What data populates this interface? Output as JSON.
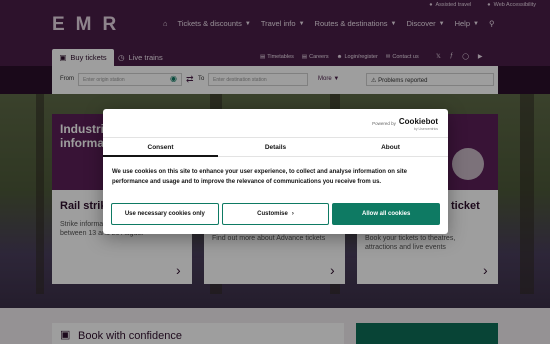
{
  "header": {
    "logo": "EMR",
    "utility_links": [
      "Assisted travel",
      "Web Accessibility"
    ],
    "nav": [
      {
        "label": "Tickets & discounts"
      },
      {
        "label": "Travel info"
      },
      {
        "label": "Routes & destinations"
      },
      {
        "label": "Discover"
      },
      {
        "label": "Help"
      }
    ]
  },
  "tabs": {
    "buy": "Buy tickets",
    "live": "Live trains"
  },
  "secondary_links": [
    "Timetables",
    "Careers",
    "Login/register",
    "Contact us"
  ],
  "social_icons": [
    "twitter-icon",
    "facebook-icon",
    "instagram-icon",
    "youtube-icon"
  ],
  "planner": {
    "from_label": "From",
    "from_placeholder": "Enter origin station",
    "to_label": "To",
    "to_placeholder": "Enter destination station",
    "more_label": "More",
    "problems_label": "Problems reported"
  },
  "background": {
    "banner_text": "Industrial action information",
    "cards": [
      {
        "title": "Rail strikes",
        "text": "Strike information for our rail network between 13 and 20 August"
      },
      {
        "title": "",
        "text": "Find out more about Advance tickets"
      },
      {
        "title": "ticket",
        "text": "Book your tickets to theatres, attractions and live events"
      }
    ],
    "book_confidence": "Book with confidence"
  },
  "cookie_modal": {
    "powered_by": "Powered by",
    "brand": "Cookiebot",
    "brand_sub": "by Usercentrics",
    "tabs": [
      "Consent",
      "Details",
      "About"
    ],
    "body": "We use cookies on this site to enhance your user experience, to collect and analyse information on site performance and usage and to improve the relevance of communications you receive from us.",
    "buttons": {
      "necessary": "Use necessary cookies only",
      "customise": "Customise",
      "allow": "Allow all cookies"
    }
  },
  "colors": {
    "brand_purple": "#4a1d48",
    "accent_green": "#0e7a63"
  }
}
